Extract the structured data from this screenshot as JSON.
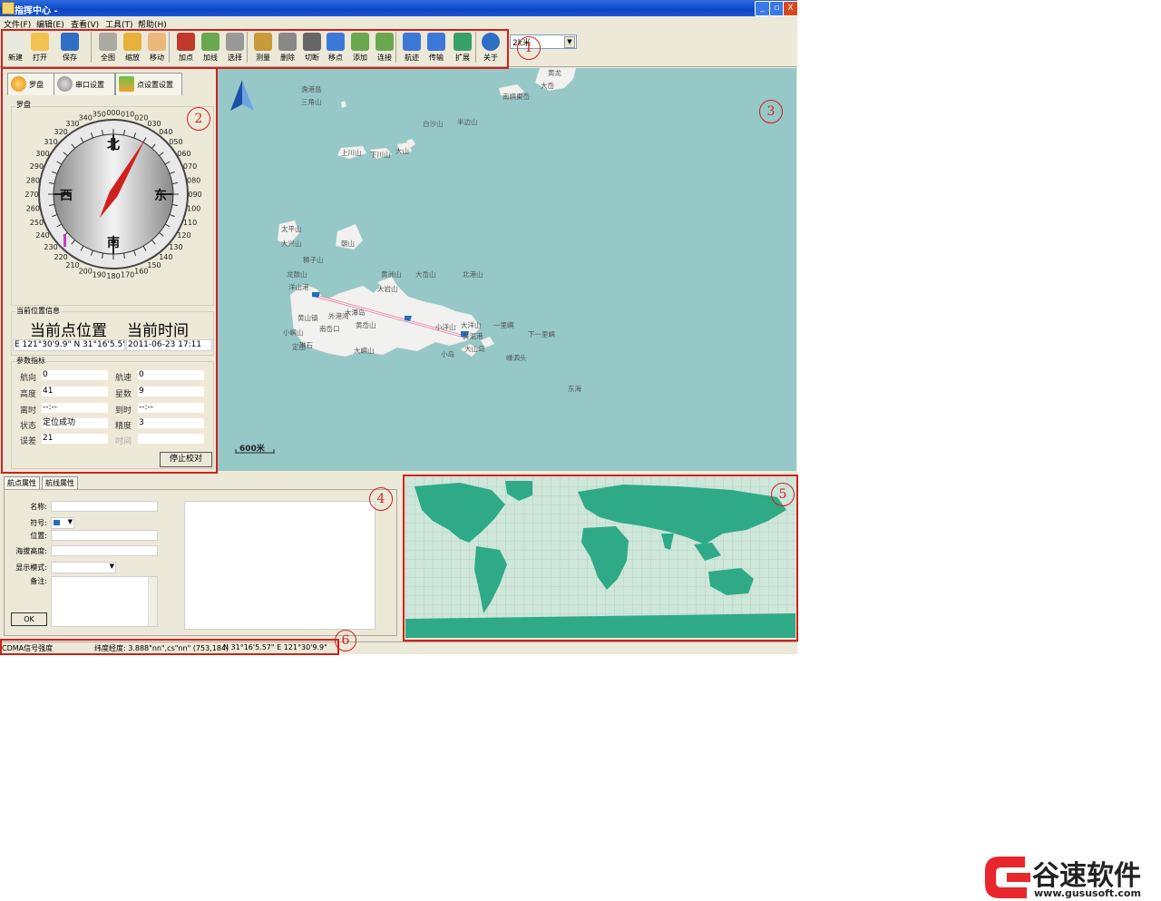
{
  "window": {
    "title": "指挥中心 -",
    "controls": {
      "minimize": "_",
      "maximize": "▫",
      "close": "X"
    }
  },
  "menu": [
    {
      "label": "文件(F)"
    },
    {
      "label": "编辑(E)"
    },
    {
      "label": "查看(V)"
    },
    {
      "label": "工具(T)"
    },
    {
      "label": "帮助(H)"
    }
  ],
  "toolbar": {
    "buttons": [
      {
        "label": "新建",
        "icon": "new-file-icon"
      },
      {
        "label": "打开",
        "icon": "open-folder-icon"
      },
      {
        "label": "保存",
        "icon": "save-disk-icon"
      },
      {
        "label": "全图",
        "icon": "full-map-icon"
      },
      {
        "label": "缩放",
        "icon": "zoom-icon"
      },
      {
        "label": "移动",
        "icon": "hand-pan-icon"
      },
      {
        "label": "加点",
        "icon": "add-point-icon"
      },
      {
        "label": "加线",
        "icon": "add-line-icon"
      },
      {
        "label": "选择",
        "icon": "select-arrow-icon"
      },
      {
        "label": "测量",
        "icon": "ruler-icon"
      },
      {
        "label": "删除",
        "icon": "delete-icon"
      },
      {
        "label": "切断",
        "icon": "cut-icon"
      },
      {
        "label": "移点",
        "icon": "move-point-icon"
      },
      {
        "label": "添加",
        "icon": "add-node-icon"
      },
      {
        "label": "连接",
        "icon": "connect-icon"
      },
      {
        "label": "航迹",
        "icon": "track-icon"
      },
      {
        "label": "传输",
        "icon": "transfer-icon"
      },
      {
        "label": "扩展",
        "icon": "extend-icon"
      },
      {
        "label": "关于",
        "icon": "help-icon"
      }
    ],
    "scale": {
      "value": "2k米"
    }
  },
  "annotations": [
    "1",
    "2",
    "3",
    "4",
    "5",
    "6"
  ],
  "left_panel": {
    "tabs": [
      {
        "label": "罗盘",
        "icon": "compass-tab-icon"
      },
      {
        "label": "串口设置",
        "icon": "gear-tab-icon"
      },
      {
        "label": "点设置设置",
        "icon": "point-settings-tab-icon"
      }
    ],
    "compass": {
      "group_label": "罗盘",
      "north": "北",
      "south": "南",
      "east": "东",
      "west": "西",
      "heading_deg": 30,
      "degree_labels": [
        "000",
        "010",
        "020",
        "030",
        "040",
        "050",
        "060",
        "070",
        "080",
        "090",
        "100",
        "110",
        "120",
        "130",
        "140",
        "150",
        "160",
        "170",
        "180",
        "190",
        "200",
        "210",
        "220",
        "230",
        "240",
        "250",
        "260",
        "270",
        "280",
        "290",
        "300",
        "310",
        "320",
        "330",
        "340",
        "350"
      ]
    },
    "position": {
      "group_label": "当前位置信息",
      "current_pos_title": "当前点位置",
      "current_time_title": "当前时间",
      "coords": "E 121°30'9.9\" N 31°16'5.5\"",
      "time": "2011-06-23 17:11"
    },
    "params": {
      "group_label": "参数指标",
      "rows": [
        {
          "l1": "航向",
          "v1": "0",
          "l2": "航速",
          "v2": "0"
        },
        {
          "l1": "高度",
          "v1": "41",
          "l2": "星数",
          "v2": "9"
        },
        {
          "l1": "离时",
          "v1": "--:--",
          "l2": "到时",
          "v2": "--:--"
        },
        {
          "l1": "状态",
          "v1": "定位成功",
          "l2": "精度",
          "v2": "3"
        },
        {
          "l1": "误差",
          "v1": "21",
          "l2": "时间",
          "v2": ""
        }
      ],
      "stop_button": "停止校对"
    }
  },
  "map": {
    "scale_bar": "600米",
    "labels": [
      {
        "t": "漁港島"
      },
      {
        "t": "三角山"
      },
      {
        "t": "黄龙"
      },
      {
        "t": "大岙"
      },
      {
        "t": "南嶼東岙"
      },
      {
        "t": "白沙山"
      },
      {
        "t": "半边山"
      },
      {
        "t": "大山"
      },
      {
        "t": "上川山"
      },
      {
        "t": "下川山"
      },
      {
        "t": "太平山"
      },
      {
        "t": "大兴山"
      },
      {
        "t": "朝山"
      },
      {
        "t": "狮子山"
      },
      {
        "t": "龙鼓山"
      },
      {
        "t": "黄洲山"
      },
      {
        "t": "大岙山"
      },
      {
        "t": "北港山"
      },
      {
        "t": "洋山港"
      },
      {
        "t": "大岩山"
      },
      {
        "t": "大潭岛"
      },
      {
        "t": "外港湾"
      },
      {
        "t": "黄山镇"
      },
      {
        "t": "南岙口"
      },
      {
        "t": "黄岙山"
      },
      {
        "t": "小洋山"
      },
      {
        "t": "大洋山"
      },
      {
        "t": "一里嶼"
      },
      {
        "t": "下一里嶼"
      },
      {
        "t": "黄泥港"
      },
      {
        "t": "大山岛"
      },
      {
        "t": "小岛"
      },
      {
        "t": "大嶼山"
      },
      {
        "t": "小嶼山"
      },
      {
        "t": "嵊泗头"
      },
      {
        "t": "礁石"
      },
      {
        "t": "定山"
      },
      {
        "t": "东海"
      }
    ]
  },
  "bottom_panel": {
    "tabs": [
      {
        "label": "航点属性"
      },
      {
        "label": "航线属性"
      }
    ],
    "fields": [
      {
        "label": "名称:"
      },
      {
        "label": "符号:"
      },
      {
        "label": "位置:"
      },
      {
        "label": "海拔高度:"
      },
      {
        "label": "显示模式:"
      },
      {
        "label": "备注:"
      }
    ],
    "ok_button": "OK"
  },
  "statusbar": {
    "signal": "CDMA信号强度",
    "latlon": "纬度经度: 3.888\"nn\",cs\"nn\" (753,184)",
    "coord": "N 31°16'5.57\" E 121°30'9.9\""
  },
  "watermark": {
    "brand": "谷速软件",
    "url": "www.gususoft.com",
    "color": "#e8262b"
  }
}
